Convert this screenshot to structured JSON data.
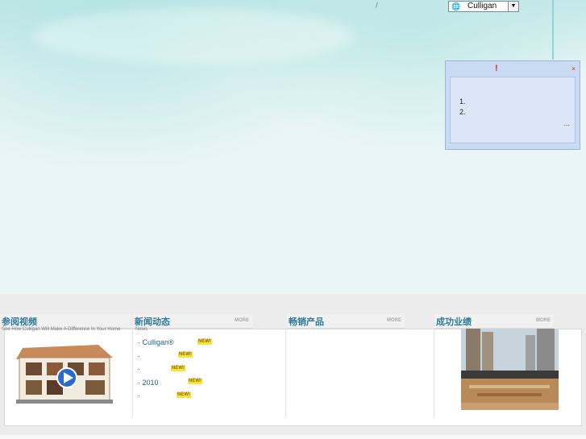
{
  "top_bar": {
    "separator": "/",
    "language_selector": {
      "value": "Culligan",
      "globe_icon": "globe-icon",
      "arrow_icon": "dropdown-arrow-icon"
    }
  },
  "notice_popup": {
    "title_mark": "!",
    "close": "×",
    "items": [
      "1.",
      "2."
    ],
    "more": "..."
  },
  "sections": {
    "videos": {
      "title": "参阅视频",
      "subtitle": "See How Culligan Will Make A Difference In Your Home"
    },
    "news": {
      "title": "新闻动态",
      "more": "MORE",
      "subtitle": "News",
      "items": [
        {
          "bullet": "·",
          "text": "Culligan®",
          "badge": "NEW!"
        },
        {
          "bullet": "·",
          "text": "",
          "badge": "NEW!"
        },
        {
          "bullet": "·",
          "text": "",
          "badge": "NEW!"
        },
        {
          "bullet": "·",
          "text": "2010",
          "badge": "NEW!"
        },
        {
          "bullet": "·",
          "text": "",
          "badge": "NEW!"
        }
      ]
    },
    "products": {
      "title": "畅销产品",
      "more": "MORE"
    },
    "cases": {
      "title": "成功业绩",
      "more": "MORE"
    }
  },
  "colors": {
    "accent": "#2f7a9a",
    "badge_bg": "#f6e53a",
    "notice_bg": "#c9dbf3"
  }
}
